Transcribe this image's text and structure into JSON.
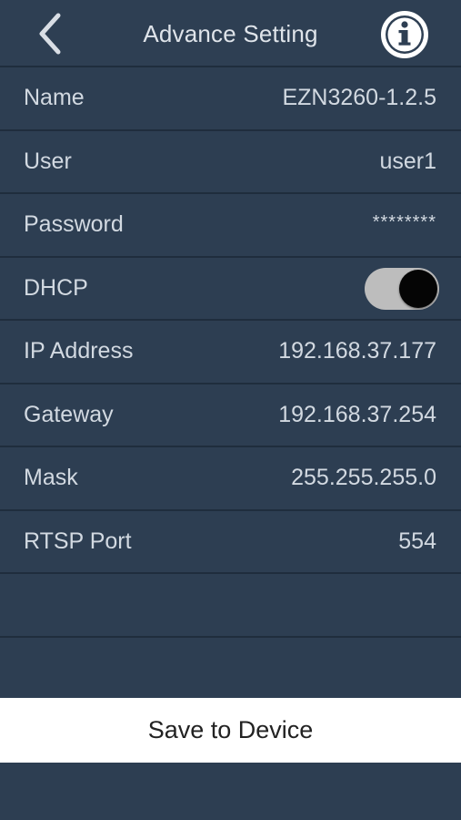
{
  "header": {
    "title": "Advance Setting",
    "back_icon": "chevron-left-icon",
    "info_icon": "info-icon"
  },
  "rows": [
    {
      "label": "Name",
      "value": "EZN3260-1.2.5"
    },
    {
      "label": "User",
      "value": "user1"
    },
    {
      "label": "Password",
      "value": "********"
    },
    {
      "label": "DHCP",
      "toggle_on": true
    },
    {
      "label": "IP Address",
      "value": "192.168.37.177"
    },
    {
      "label": "Gateway",
      "value": "192.168.37.254"
    },
    {
      "label": "Mask",
      "value": "255.255.255.0"
    },
    {
      "label": "RTSP Port",
      "value": "554"
    }
  ],
  "footer": {
    "save_label": "Save to Device"
  },
  "colors": {
    "background": "#2d3e52",
    "divider": "#1f2d3d",
    "toggle_track": "#bdbdbd",
    "toggle_knob": "#050505",
    "save_bar": "#ffffff"
  }
}
